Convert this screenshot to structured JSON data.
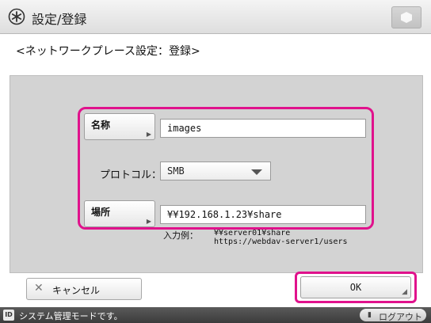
{
  "header": {
    "icon": "settings-asterisk-icon",
    "title": "設定/登録",
    "corner_button_icon": "cube-icon"
  },
  "subtitle": "<ネットワークプレース設定：登録>",
  "form": {
    "name": {
      "button_label": "名称",
      "value": "images"
    },
    "protocol": {
      "label": "プロトコル：",
      "selected": "SMB"
    },
    "location": {
      "button_label": "場所",
      "value": "¥¥192.168.1.23¥share"
    },
    "example": {
      "label": "入力例：",
      "lines": [
        "¥¥server01¥share",
        "https://webdav-server1/users"
      ]
    }
  },
  "footer": {
    "cancel_label": "キャンセル",
    "ok_label": "OK"
  },
  "status": {
    "badge": "ID",
    "message": "システム管理モードです。",
    "logout_label": "ログアウト"
  },
  "colors": {
    "highlight": "#e0128c",
    "panel": "#d3d3d3",
    "statusbar": "#444444"
  }
}
